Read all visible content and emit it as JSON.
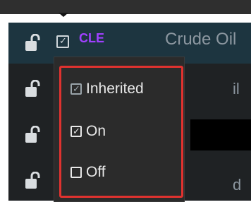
{
  "row": {
    "code": "CLE",
    "description": "Crude Oil",
    "partial_right_1": "il",
    "partial_right_2": "d"
  },
  "menu": {
    "options": [
      {
        "label": "Inherited",
        "state": "dim-checked"
      },
      {
        "label": "On",
        "state": "checked"
      },
      {
        "label": "Off",
        "state": "unchecked"
      }
    ]
  },
  "colors": {
    "code_text": "#a040ff",
    "highlight_border": "#e0322f",
    "selected_row": "#1d3540"
  },
  "icons": [
    "unlock-icon",
    "checkbox-icon"
  ]
}
